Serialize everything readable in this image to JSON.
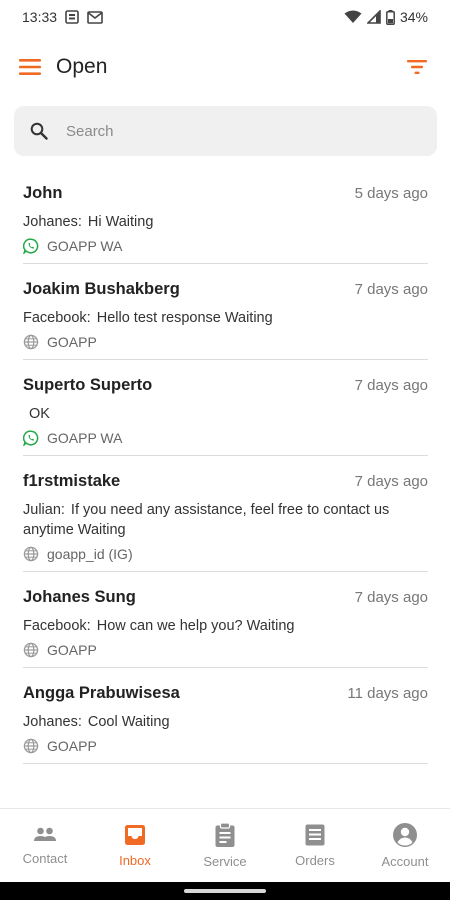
{
  "status_bar": {
    "time": "13:33",
    "battery": "34%"
  },
  "app_bar": {
    "title": "Open"
  },
  "search": {
    "placeholder": "Search"
  },
  "conversations": [
    {
      "name": "John",
      "time": "5 days ago",
      "sender": "Johanes:",
      "message": "Hi Waiting",
      "channel": "GOAPP WA",
      "channel_icon": "whatsapp-icon"
    },
    {
      "name": "Joakim Bushakberg",
      "time": "7 days ago",
      "sender": "Facebook:",
      "message": "Hello test response Waiting",
      "channel": "GOAPP",
      "channel_icon": "globe-icon"
    },
    {
      "name": "Superto Superto",
      "time": "7 days ago",
      "sender": "",
      "message": "OK",
      "channel": "GOAPP WA",
      "channel_icon": "whatsapp-icon"
    },
    {
      "name": "f1rstmistake",
      "time": "7 days ago",
      "sender": "Julian:",
      "message": "If you need any assistance, feel free to contact us anytime Waiting",
      "channel": "goapp_id (IG)",
      "channel_icon": "globe-icon"
    },
    {
      "name": "Johanes Sung",
      "time": "7 days ago",
      "sender": "Facebook:",
      "message": "How can we help you? Waiting",
      "channel": "GOAPP",
      "channel_icon": "globe-icon"
    },
    {
      "name": "Angga Prabuwisesa",
      "time": "11 days ago",
      "sender": "Johanes:",
      "message": "Cool Waiting",
      "channel": "GOAPP",
      "channel_icon": "globe-icon"
    }
  ],
  "bottom_nav": {
    "active": "Inbox",
    "items": [
      {
        "label": "Contact",
        "icon": "contacts-icon"
      },
      {
        "label": "Inbox",
        "icon": "inbox-icon"
      },
      {
        "label": "Service",
        "icon": "clipboard-icon"
      },
      {
        "label": "Orders",
        "icon": "orders-icon"
      },
      {
        "label": "Account",
        "icon": "account-icon"
      }
    ]
  },
  "colors": {
    "accent": "#f06a24",
    "whatsapp": "#25a84a",
    "muted": "#8f8f8f"
  }
}
